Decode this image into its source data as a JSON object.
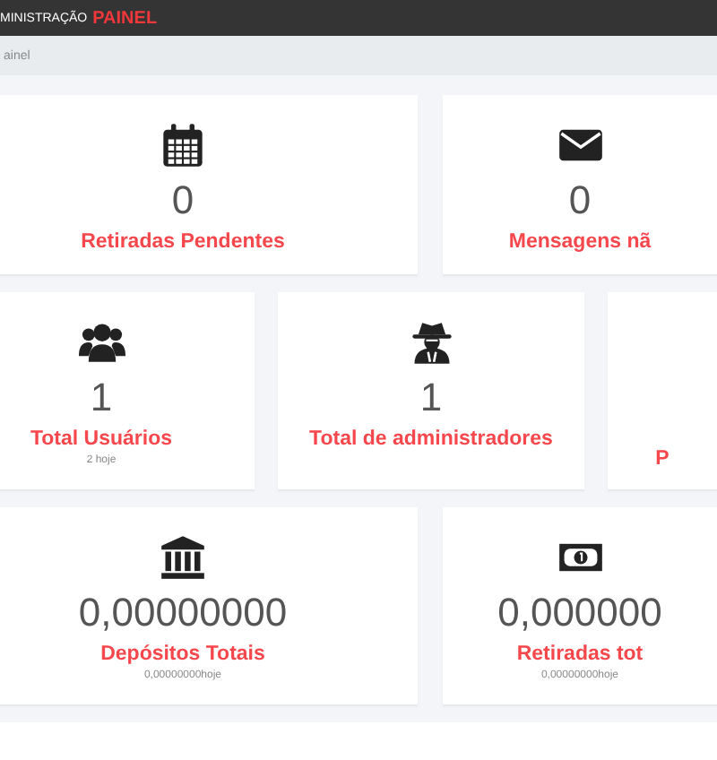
{
  "header": {
    "title_prefix": "MINISTRAÇÃO",
    "title_accent": "PAINEL"
  },
  "breadcrumb": "ainel",
  "rows": [
    {
      "cards": [
        {
          "kind": "calendar",
          "value": "0",
          "label": "Retiradas Pendentes"
        },
        {
          "kind": "envelope",
          "value": "0",
          "label": "Mensagens nã"
        }
      ]
    },
    {
      "cards": [
        {
          "kind": "users",
          "value": "1",
          "label": "Total Usuários",
          "sub": "2 hoje"
        },
        {
          "kind": "spy",
          "value": "1",
          "label": "Total de administradores"
        },
        {
          "kind": "bare",
          "label": "P"
        }
      ]
    },
    {
      "cards": [
        {
          "kind": "bank",
          "value": "0,00000000",
          "label": "Depósitos Totais",
          "sub": "0,00000000hoje"
        },
        {
          "kind": "money",
          "value": "0,000000",
          "label": "Retiradas tot",
          "sub": "0,00000000hoje"
        }
      ]
    }
  ]
}
